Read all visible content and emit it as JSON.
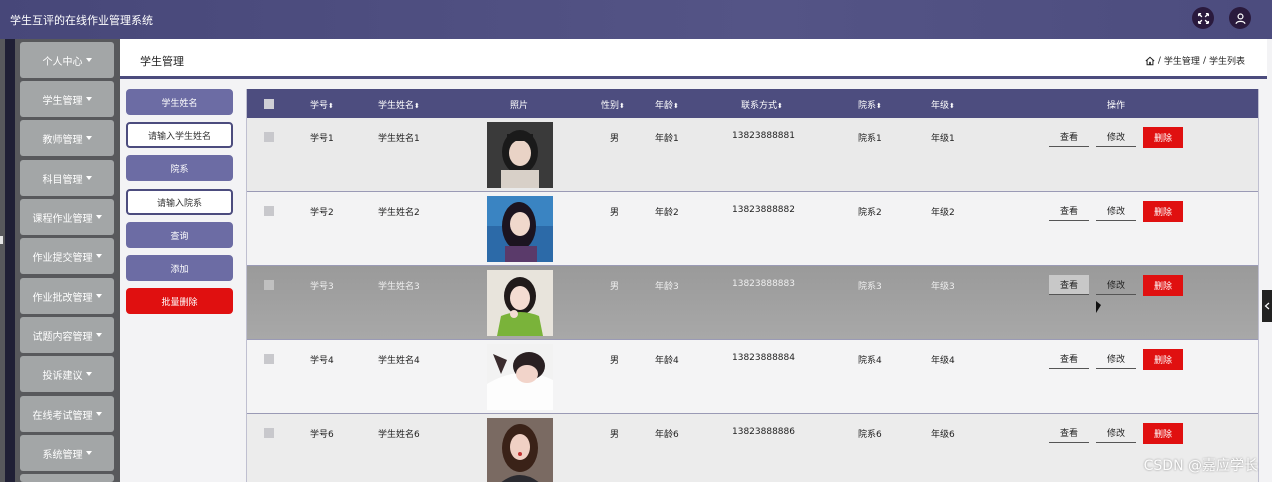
{
  "app": {
    "title": "学生互评的在线作业管理系统"
  },
  "topbar": {
    "icons": [
      "fullscreen-icon",
      "user-icon"
    ]
  },
  "sidebar": {
    "items": [
      {
        "label": "个人中心"
      },
      {
        "label": "学生管理"
      },
      {
        "label": "教师管理"
      },
      {
        "label": "科目管理"
      },
      {
        "label": "课程作业管理"
      },
      {
        "label": "作业提交管理"
      },
      {
        "label": "作业批改管理"
      },
      {
        "label": "试题内容管理"
      },
      {
        "label": "投诉建议"
      },
      {
        "label": "在线考试管理"
      },
      {
        "label": "系统管理"
      }
    ]
  },
  "header": {
    "title": "学生管理",
    "breadcrumb": {
      "home_icon": "home-icon",
      "sep1": "/",
      "level1": "学生管理",
      "sep2": "/",
      "level2": "学生列表"
    }
  },
  "search": {
    "name_label": "学生姓名",
    "name_placeholder": "请输入学生姓名",
    "dept_label": "院系",
    "dept_placeholder": "请输入院系",
    "query_button": "查询",
    "add_button": "添加",
    "batch_delete_button": "批量删除"
  },
  "table": {
    "columns": {
      "id": "学号",
      "name": "学生姓名",
      "photo": "照片",
      "gender": "性别",
      "age": "年龄",
      "contact": "联系方式",
      "dept": "院系",
      "grade": "年级",
      "actions": "操作"
    },
    "sort_glyph": "⬍",
    "action_labels": {
      "view": "查看",
      "edit": "修改",
      "delete": "删除"
    },
    "rows": [
      {
        "id": "学号1",
        "name": "学生姓名1",
        "gender": "男",
        "age": "年龄1",
        "contact": "13823888881",
        "dept": "院系1",
        "grade": "年级1"
      },
      {
        "id": "学号2",
        "name": "学生姓名2",
        "gender": "男",
        "age": "年龄2",
        "contact": "13823888882",
        "dept": "院系2",
        "grade": "年级2"
      },
      {
        "id": "学号3",
        "name": "学生姓名3",
        "gender": "男",
        "age": "年龄3",
        "contact": "13823888883",
        "dept": "院系3",
        "grade": "年级3"
      },
      {
        "id": "学号4",
        "name": "学生姓名4",
        "gender": "男",
        "age": "年龄4",
        "contact": "13823888884",
        "dept": "院系4",
        "grade": "年级4"
      },
      {
        "id": "学号6",
        "name": "学生姓名6",
        "gender": "男",
        "age": "年龄6",
        "contact": "13823888886",
        "dept": "院系6",
        "grade": "年级6"
      }
    ]
  },
  "watermark": "CSDN @嘉应学长",
  "colors": {
    "topbar": "#4c4c7e",
    "accent": "#6c6ca4",
    "danger": "#e01010",
    "sidebar_item": "#a3a6a7",
    "hover_row": "#a4a4a4"
  }
}
